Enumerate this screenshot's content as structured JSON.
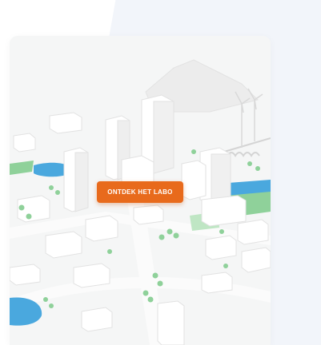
{
  "hero": {
    "cta_label": "ONTDEK HET LABO"
  },
  "colors": {
    "accent": "#e86a1c",
    "background_panel": "#f2f5fa",
    "water": "#4aa8de",
    "greenery": "#8fd19a"
  },
  "icons": [
    "city-illustration",
    "wind-turbine-icon",
    "tree-icon",
    "bridge-icon"
  ]
}
